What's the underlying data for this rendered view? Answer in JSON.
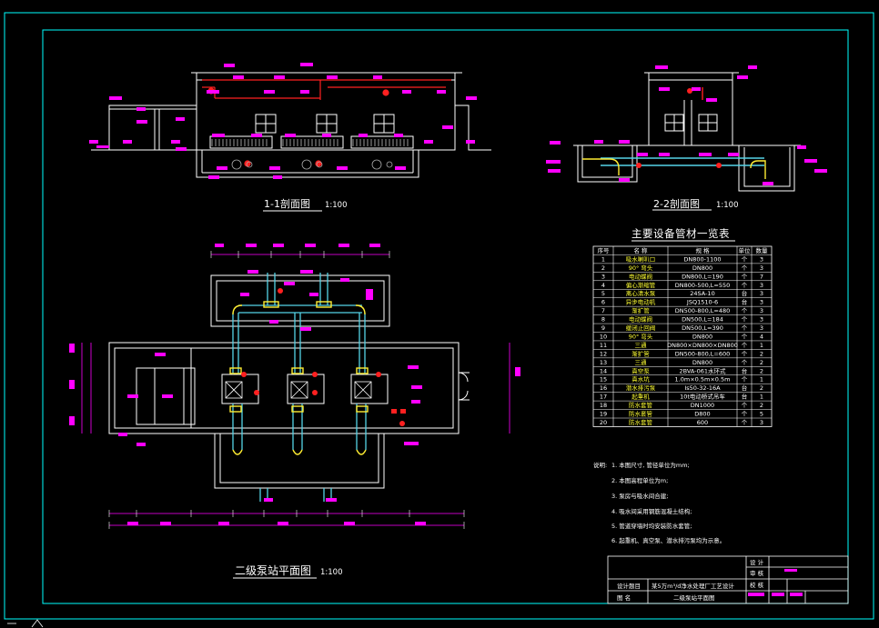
{
  "drawing": {
    "section_1_title": "1-1剖面图",
    "section_1_scale": "1:100",
    "section_2_title": "2-2剖面图",
    "section_2_scale": "1:100",
    "plan_title": "二级泵站平面图",
    "plan_scale": "1:100",
    "table_title": "主要设备管材一览表"
  },
  "equipment_table": {
    "headers": [
      "序号",
      "名 称",
      "规 格",
      "单位",
      "数量"
    ],
    "rows": [
      [
        "1",
        "吸水喇叭口",
        "DN800-1100",
        "个",
        "3"
      ],
      [
        "2",
        "90° 弯头",
        "DN800",
        "个",
        "3"
      ],
      [
        "3",
        "电动蝶阀",
        "DN800,L=190",
        "个",
        "7"
      ],
      [
        "4",
        "偏心渐缩管",
        "DN800-500,L=550",
        "个",
        "3"
      ],
      [
        "5",
        "离心清水泵",
        "24SA-10",
        "台",
        "3"
      ],
      [
        "6",
        "异步电动机",
        "JSQ1510-6",
        "台",
        "3"
      ],
      [
        "7",
        "渐扩管",
        "DN500-800,L=480",
        "个",
        "3"
      ],
      [
        "8",
        "电动蝶阀",
        "DN500,L=184",
        "个",
        "3"
      ],
      [
        "9",
        "缓闭止回阀",
        "DN500,L=390",
        "个",
        "3"
      ],
      [
        "10",
        "90° 弯头",
        "DN800",
        "个",
        "4"
      ],
      [
        "11",
        "三通",
        "DN800×DN800×DN800",
        "个",
        "1"
      ],
      [
        "12",
        "渐扩管",
        "DN500-800,L=600",
        "个",
        "2"
      ],
      [
        "13",
        "三通",
        "DN800",
        "个",
        "2"
      ],
      [
        "14",
        "真空泵",
        "2BVA-061水环式",
        "台",
        "2"
      ],
      [
        "15",
        "真水坑",
        "1.0m×0.5m×0.5m",
        "个",
        "1"
      ],
      [
        "16",
        "潜水排污泵",
        "Is50-32-16A",
        "台",
        "2"
      ],
      [
        "17",
        "起重机",
        "10t电动桥式吊车",
        "台",
        "1"
      ],
      [
        "18",
        "防水套管",
        "DN1000",
        "个",
        "2"
      ],
      [
        "19",
        "防水套管",
        "D800",
        "个",
        "5"
      ],
      [
        "20",
        "防水套管",
        "600",
        "个",
        "3"
      ]
    ]
  },
  "notes": {
    "heading": "说明:",
    "items": [
      "1. 本图尺寸, 管径单位为mm;",
      "2. 本图高程单位为m;",
      "3. 泵房与吸水间合建;",
      "4. 吸水间采用钢筋混凝土结构;",
      "5. 管道穿墙时均安装防水套管;",
      "6. 起重机、真空泵、潜水排污泵均为示意。"
    ]
  },
  "title_block": {
    "design_label": "设计题目",
    "design_value": "某5万m³/d净水处理厂工艺设计",
    "drawing_label": "图 名",
    "drawing_value": "二级泵站平面图",
    "row1_a": "设 计",
    "row1_b": "审 核",
    "row1_c": "校 核"
  },
  "colors": {
    "background": "#000000",
    "frame": "#00ffff",
    "walls": "#ffffff",
    "dimension": "#ff00ff",
    "pipe_red": "#ff2020",
    "pipe_cyan": "#55d4e8",
    "fitting_yellow": "#ffee33"
  }
}
